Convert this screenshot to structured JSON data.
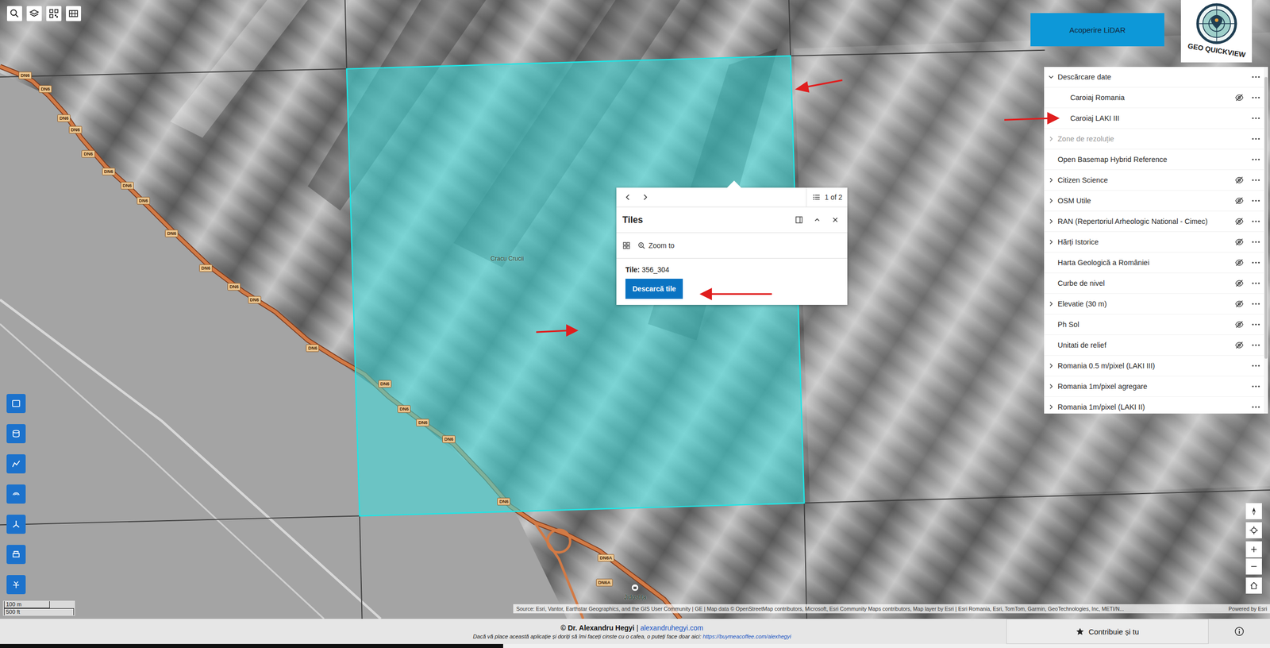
{
  "map": {
    "place_labels": [
      "Cracu Crucii",
      "Jidostița"
    ],
    "road_shields": [
      "DN6",
      "DN6",
      "DN6",
      "DN6",
      "DN6",
      "DN6",
      "DN6",
      "DN6",
      "DN6",
      "DN6",
      "DN6",
      "DN6",
      "DN6",
      "DN6",
      "DN6",
      "DN6",
      "DN6",
      "DN6",
      "DN6A",
      "DN6A"
    ],
    "scale": [
      "100 m",
      "500 ft"
    ],
    "attribution": "Source: Esri, Vantor, Earthstar Geographics, and the GIS User Community | GE | Map data © OpenStreetMap contributors, Microsoft, Esri Community Maps contributors, Map layer by Esri | Esri Romania, Esri, TomTom, Garmin, GeoTechnologies, Inc, METI/N...",
    "powered_by": "Powered by Esri"
  },
  "coverage_button": {
    "label": "Acoperire LiDAR"
  },
  "logo": {
    "text": "GEO QUICKVIEW"
  },
  "popup": {
    "pager": "1 of 2",
    "title": "Tiles",
    "action": "Zoom to",
    "field_label": "Tile:",
    "field_value": "356_304",
    "button": "Descarcă tile"
  },
  "layer_list": {
    "items": [
      {
        "label": "Descărcare date",
        "kind": "group",
        "child": false,
        "expanded": true,
        "visible": true,
        "disabled": false
      },
      {
        "label": "Caroiaj Romania",
        "kind": "layer",
        "child": true,
        "expanded": false,
        "visible": false,
        "disabled": false
      },
      {
        "label": "Caroiaj LAKI III",
        "kind": "layer",
        "child": true,
        "expanded": false,
        "visible": true,
        "disabled": false
      },
      {
        "label": "Zone de rezoluție",
        "kind": "group",
        "child": false,
        "expanded": false,
        "visible": true,
        "disabled": true
      },
      {
        "label": "Open Basemap Hybrid Reference",
        "kind": "layer",
        "child": false,
        "expanded": false,
        "visible": true,
        "disabled": false
      },
      {
        "label": "Citizen Science",
        "kind": "group",
        "child": false,
        "expanded": false,
        "visible": false,
        "disabled": false
      },
      {
        "label": "OSM Utile",
        "kind": "group",
        "child": false,
        "expanded": false,
        "visible": false,
        "disabled": false
      },
      {
        "label": "RAN (Repertoriul Arheologic National - Cimec)",
        "kind": "group",
        "child": false,
        "expanded": false,
        "visible": false,
        "disabled": false
      },
      {
        "label": "Hărți Istorice",
        "kind": "group",
        "child": false,
        "expanded": false,
        "visible": false,
        "disabled": false
      },
      {
        "label": "Harta Geologică a României",
        "kind": "layer",
        "child": false,
        "expanded": false,
        "visible": false,
        "disabled": false
      },
      {
        "label": "Curbe de nivel",
        "kind": "layer",
        "child": false,
        "expanded": false,
        "visible": false,
        "disabled": false
      },
      {
        "label": "Elevatie (30 m)",
        "kind": "group",
        "child": false,
        "expanded": false,
        "visible": false,
        "disabled": false
      },
      {
        "label": "Ph Sol",
        "kind": "layer",
        "child": false,
        "expanded": false,
        "visible": false,
        "disabled": false
      },
      {
        "label": "Unitati de relief",
        "kind": "layer",
        "child": false,
        "expanded": false,
        "visible": false,
        "disabled": false
      },
      {
        "label": "Romania 0.5 m/pixel (LAKI III)",
        "kind": "group",
        "child": false,
        "expanded": false,
        "visible": true,
        "disabled": false
      },
      {
        "label": "Romania 1m/pixel agregare",
        "kind": "group",
        "child": false,
        "expanded": false,
        "visible": true,
        "disabled": false
      },
      {
        "label": "Romania 1m/pixel (LAKI II)",
        "kind": "group",
        "child": false,
        "expanded": false,
        "visible": true,
        "disabled": false
      }
    ]
  },
  "footer": {
    "author": "© Dr. Alexandru Hegyi",
    "separator": "|",
    "site": "alexandruhegyi.com",
    "note": "Dacă vă place această aplicație și doriți să îmi faceți cinste cu o cafea, o puteți face doar aici:",
    "note_link": "https://buymeacoffee.com/alexhegyi",
    "contribute": "Contribuie și tu"
  }
}
